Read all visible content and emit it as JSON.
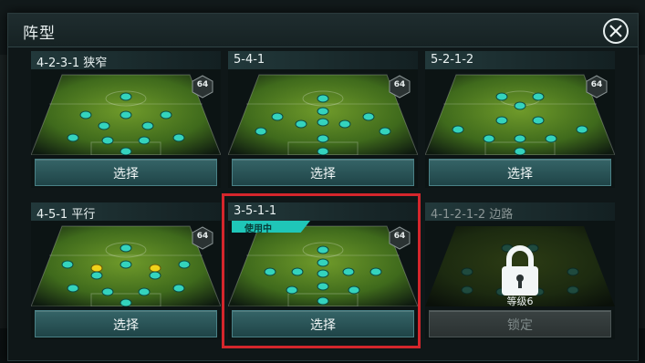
{
  "title": "阵型",
  "close_icon": "close-icon",
  "select_label": "选择",
  "in_use_label": "使用中",
  "locked_button_label": "锁定",
  "level_requirement": "等级6",
  "accent_color": "#1fc6b8",
  "highlight_color": "#d5262c",
  "formations": [
    {
      "name": "4-2-3-1 狭窄",
      "rating": "64",
      "state": "available"
    },
    {
      "name": "5-4-1",
      "rating": "64",
      "state": "available"
    },
    {
      "name": "5-2-1-2",
      "rating": "64",
      "state": "available"
    },
    {
      "name": "4-5-1 平行",
      "rating": "64",
      "state": "available"
    },
    {
      "name": "3-5-1-1",
      "rating": "64",
      "state": "in_use"
    },
    {
      "name": "4-1-2-1-2 边路",
      "rating": "",
      "state": "locked"
    }
  ]
}
